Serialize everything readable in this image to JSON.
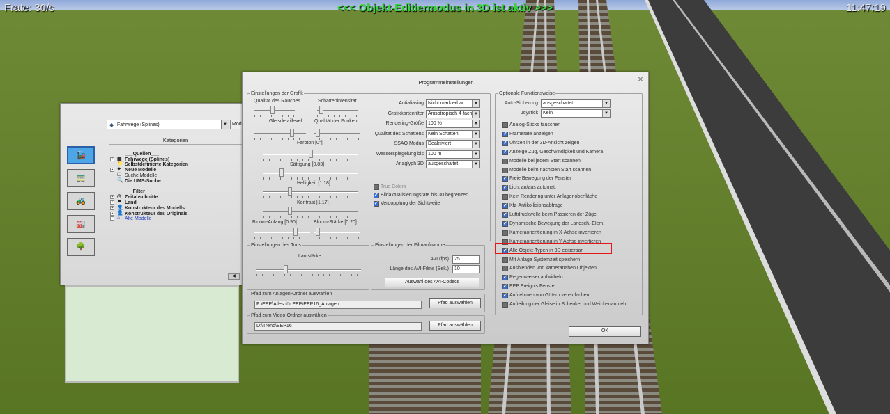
{
  "hud": {
    "fps": "Frate: 30/s",
    "mode": "<<< Objekt-Editiermodus in 3D ist aktiv >>>",
    "clock": "11:47:19"
  },
  "tree_panel": {
    "category_select": "Fahrwege (Splines)",
    "mode_tab": "Mode",
    "categories_title": "Kategorien",
    "side_icons": [
      "locomotive-icon",
      "wagon-icon",
      "crane-vehicle-icon",
      "structure-icon",
      "landscape-icon"
    ],
    "tree_items": [
      {
        "label": "",
        "style": "spacer"
      },
      {
        "label": "___Quellen___",
        "style": "b",
        "pm": ""
      },
      {
        "label": "Fahrwege (Splines)",
        "style": "b",
        "pm": "+",
        "icon": "track-icon"
      },
      {
        "label": "Selbstdefinierte Kategorien",
        "style": "b",
        "pm": "",
        "icon": "folder-icon"
      },
      {
        "label": "Neue Modelle",
        "style": "b",
        "pm": "+",
        "icon": "new-models-icon"
      },
      {
        "label": "Suche Modelle",
        "style": "",
        "pm": "",
        "icon": "search-list-icon"
      },
      {
        "label": "Die UMS-Suche",
        "style": "b",
        "pm": "",
        "icon": "magnifier-icon"
      },
      {
        "label": "",
        "style": "spacer"
      },
      {
        "label": "___Filter___",
        "style": "b",
        "pm": ""
      },
      {
        "label": "Zeitabschnitte",
        "style": "b",
        "pm": "+",
        "icon": "clock-icon"
      },
      {
        "label": "Land",
        "style": "b",
        "pm": "+",
        "icon": "flag-icon"
      },
      {
        "label": "Konstrukteur des Modells",
        "style": "b",
        "pm": "+",
        "icon": "person-icon"
      },
      {
        "label": "Konstrukteur des Originals",
        "style": "b",
        "pm": "+",
        "icon": "person-icon"
      },
      {
        "label": "Alte Modelle",
        "style": "blue",
        "pm": "+",
        "icon": "old-models-icon"
      }
    ]
  },
  "settings": {
    "title": "Programmeinstellungen",
    "graphics": {
      "legend": "Einstellungen der Grafik",
      "sliders": [
        {
          "label": "Qualität des Rauches",
          "value": 0.45
        },
        {
          "label": "Schattenintensität",
          "value": 0.05
        },
        {
          "label": "Gleisdetaillevel",
          "value": 0.75
        },
        {
          "label": "Qualität der Funken",
          "value": 0.05
        },
        {
          "label": "Farbton [0°]",
          "value": 0.5
        },
        {
          "label": "Sättigung [0.83]",
          "value": 0.18
        },
        {
          "label": "Helligkeit [1.18]",
          "value": 0.27
        },
        {
          "label": "Kontrast [1.17]",
          "value": 0.27
        },
        {
          "label": "Bloom-Anfang [0.90]",
          "value": 0.75
        },
        {
          "label": "Bloom-Stärke [0.20]",
          "value": 0.05
        }
      ],
      "options": [
        {
          "label": "Antialiasing",
          "value": "Nicht markierbar"
        },
        {
          "label": "Grafikkartenfilter",
          "value": "Anisotropisch 4-fach"
        },
        {
          "label": "Rendering-Größe",
          "value": "100 %"
        },
        {
          "label": "Qualität des Schattens",
          "value": "Kein Schatten"
        },
        {
          "label": "SSAO Modus",
          "value": "Deaktiviert"
        },
        {
          "label": "Wasserspiegelung bis",
          "value": "100 m"
        },
        {
          "label": "Anaglyph 3D",
          "value": "ausgeschaltet"
        }
      ],
      "checks": [
        {
          "label": "True Colors",
          "state": "off",
          "disabled": true
        },
        {
          "label": "Bildaktualisierungsrate bis 30 begrenzen",
          "state": "on"
        },
        {
          "label": "Verdopplung der Sichtweite",
          "state": "on"
        }
      ]
    },
    "sound": {
      "legend": "Einstellungen des Tons",
      "volume_label": "Lautstärke",
      "volume": 0.27
    },
    "film": {
      "legend": "Einstellungen der Filmaufnahme",
      "avi_fps_label": "AVI (fps)",
      "avi_fps": "25",
      "avi_len_label": "Länge des AVI-Films (Sek.)",
      "avi_len": "10",
      "codec_button": "Auswahl des AVI-Codecs"
    },
    "layout_path": {
      "legend": "Pfad zum Anlagen-Ordner auswählen",
      "value": "F:\\EEP\\Alles für EEP\\EEP16_Anlagen",
      "button": "Pfad auswählen"
    },
    "video_path": {
      "legend": "Pfad zum Video-Ordner auswählen",
      "value": "D:\\Trend\\EEP16",
      "button": "Pfad auswählen"
    },
    "optional": {
      "legend": "Optionale Funktionsweise",
      "autosave_label": "Auto-Sicherung",
      "autosave": "ausgeschaltet",
      "joystick_label": "Joystick",
      "joystick": "Kein",
      "checks": [
        {
          "label": "Analog-Sticks tauschen",
          "state": "off"
        },
        {
          "label": "Framerate anzeigen",
          "state": "on"
        },
        {
          "label": "Uhrzeit in der 3D-Ansicht zeigen",
          "state": "on"
        },
        {
          "label": "Anzeige Zug, Geschwindigkeit und Kamera",
          "state": "on"
        },
        {
          "label": "Modelle bei jedem Start scannen",
          "state": "off"
        },
        {
          "label": "Modelle beim nächsten Start scannen",
          "state": "off"
        },
        {
          "label": "Freie Bewegung der Fenster",
          "state": "on"
        },
        {
          "label": "Licht an/aus automat.",
          "state": "on"
        },
        {
          "label": "Kein Rendering unter Anlagenoberfläche",
          "state": "off"
        },
        {
          "label": "Kfz-Antikollisionsabfrage",
          "state": "on"
        },
        {
          "label": "Luftdruckwelle beim Passieren der Züge",
          "state": "on"
        },
        {
          "label": "Dynamische Bewegung der Landsch.-Elem.",
          "state": "on"
        },
        {
          "label": "Kameraorientierung in X-Achse invertieren",
          "state": "off"
        },
        {
          "label": "Kameraorientierung in Y-Achse invertieren",
          "state": "off"
        },
        {
          "label": "Alle Objekt-Typen in 3D editierbar",
          "state": "on"
        },
        {
          "label": "Mit Anlage Systemzeit speichern",
          "state": "off"
        },
        {
          "label": "Ausblenden von kameranahen Objekten",
          "state": "off"
        },
        {
          "label": "Regenwasser aufwirbeln",
          "state": "on"
        },
        {
          "label": "EEP Ereignis Fenster",
          "state": "on"
        },
        {
          "label": "Aufnehmen von Gütern vereinfachen",
          "state": "on"
        },
        {
          "label": "Aufteilung der Gleise in Schenkel und Weichenantrieb.",
          "state": "off"
        }
      ]
    },
    "ok": "OK"
  },
  "colors": {
    "hud_green": "#39d43b",
    "highlight": "#e01818",
    "checkbox_on": "#3a6fd8"
  }
}
